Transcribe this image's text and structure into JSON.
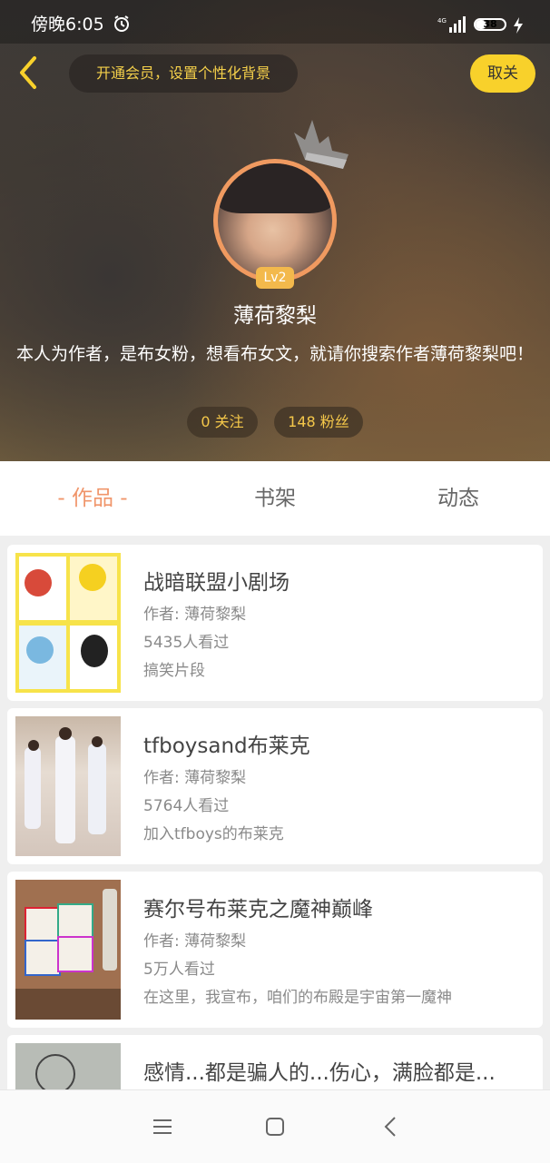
{
  "status_bar": {
    "time": "傍晚6:05",
    "network": "4G",
    "battery": "38"
  },
  "header": {
    "member_prompt": "开通会员，设置个性化背景",
    "follow_label": "取关",
    "level": "Lv2",
    "username": "薄荷黎梨",
    "bio": "本人为作者，是布女粉，想看布女文，就请你搜索作者薄荷黎梨吧！",
    "following": "0 关注",
    "fans": "148 粉丝"
  },
  "tabs": [
    {
      "label": "- 作品 -"
    },
    {
      "label": "书架"
    },
    {
      "label": "动态"
    }
  ],
  "works": [
    {
      "title": "战暗联盟小剧场",
      "author": "作者: 薄荷黎梨",
      "views": "5435人看过",
      "desc": "搞笑片段"
    },
    {
      "title": "tfboysand布莱克",
      "author": "作者: 薄荷黎梨",
      "views": "5764人看过",
      "desc": "加入tfboys的布莱克"
    },
    {
      "title": "赛尔号布莱克之魔神巅峰",
      "author": "作者: 薄荷黎梨",
      "views": "5万人看过",
      "desc": "在这里，我宣布，咱们的布殿是宇宙第一魔神"
    },
    {
      "title": "感情...都是骗人的...伤心，满脸都是...",
      "author": "",
      "views": "",
      "desc": ""
    }
  ],
  "colors": {
    "accent": "#f0956a",
    "gold": "#f8d12b",
    "stat_text": "#f5c84a"
  },
  "icons": [
    "back-icon",
    "alarm-icon",
    "signal-icon",
    "battery-icon",
    "charging-icon",
    "crown-icon",
    "menu-icon",
    "home-icon",
    "nav-back-icon"
  ]
}
